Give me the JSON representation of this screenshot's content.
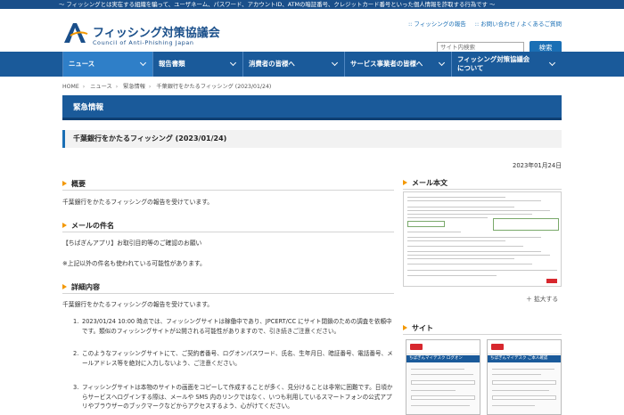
{
  "topbar": {
    "text": "～ フィッシングとは実在する組織を騙って、ユーザネーム、パスワード、アカウントID、ATMの暗証番号、クレジットカード番号といった個人情報を詐取する行為です ～"
  },
  "header": {
    "logo_jp": "フィッシング対策協議会",
    "logo_en": "Council of Anti-Phishing Japan",
    "util_links": [
      "フィッシングの報告",
      "お問い合わせ / よくあるご質問"
    ],
    "search_placeholder": "サイト内検索",
    "search_button": "検索"
  },
  "nav": {
    "items": [
      {
        "label": "ニュース"
      },
      {
        "label": "報告書類"
      },
      {
        "label": "消費者の皆様へ"
      },
      {
        "label": "サービス事業者の皆様へ"
      },
      {
        "label_line1": "フィッシング対策協議会",
        "label_line2": "について"
      }
    ]
  },
  "breadcrumb": [
    "HOME",
    "ニュース",
    "緊急情報",
    "千葉銀行をかたるフィッシング (2023/01/24)"
  ],
  "section_band": "緊急情報",
  "article": {
    "title": "千葉銀行をかたるフィッシング (2023/01/24)",
    "date": "2023年01月24日",
    "overview_heading": "概要",
    "overview_text": "千葉銀行をかたるフィッシングの報告を受けています。",
    "subject_heading": "メールの件名",
    "subject_text": "【ちばぎんアプリ】お取引目的等のご確認のお願い",
    "subject_note": "※上記以外の件名も使われている可能性があります。",
    "details_heading": "詳細内容",
    "details_text": "千葉銀行をかたるフィッシングの報告を受けています。",
    "list": [
      {
        "num": "1.",
        "text": "2023/01/24 10:00 時点では、フィッシングサイトは稼働中であり、JPCERT/CC にサイト閉鎖のための調査を依頼中です。類似のフィッシングサイトが公開される可能性がありますので、引き続きご注意ください。"
      },
      {
        "num": "2.",
        "text": "このようなフィッシングサイトにて、ご契約者番号、ログオンパスワード、氏名、生年月日、暗証番号、電話番号、メールアドレス等を絶対に入力しないよう、ご注意ください。"
      },
      {
        "num": "3.",
        "text": "フィッシングサイトは本物のサイトの画面をコピーして作成することが多く、見分けることは非常に困難です。日頃からサービスへログインする際は、メールや SMS 内のリンクではなく、いつも利用しているスマートフォンの公式アプリやブラウザーのブックマークなどからアクセスするよう、心がけてください。"
      }
    ]
  },
  "sidebar": {
    "mail_heading": "メール本文",
    "expand_label": "＋ 拡大する",
    "site_heading": "サイト",
    "site_thumbs": [
      {
        "bar": "ちばぎんマイデスク  ログオン"
      },
      {
        "bar": "ちばぎんマイデスク  ご本人確認"
      }
    ]
  },
  "colors": {
    "brand_blue": "#1a5a9a",
    "accent_orange": "#f39800",
    "link_blue": "#1a6fb5"
  }
}
